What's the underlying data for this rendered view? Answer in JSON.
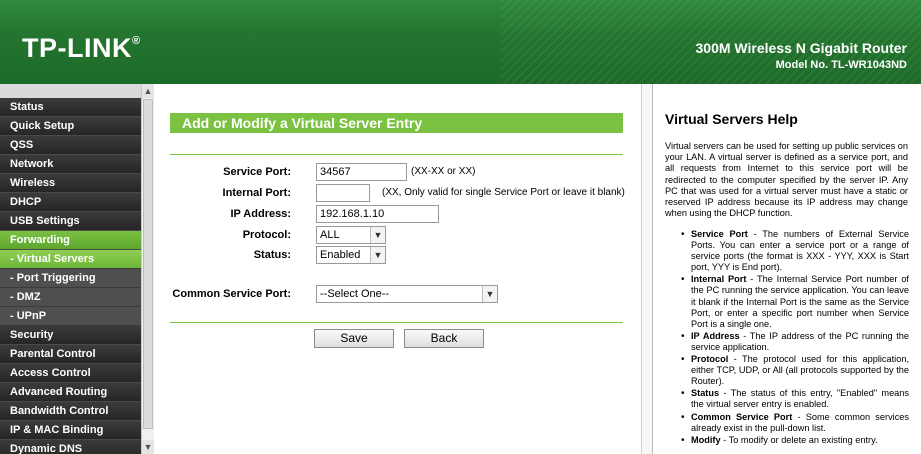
{
  "header": {
    "logo": "TP-LINK",
    "logo_mark": "®",
    "router_name": "300M Wireless N Gigabit Router",
    "model": "Model No. TL-WR1043ND"
  },
  "menu": {
    "items": [
      {
        "label": "Status",
        "type": "main"
      },
      {
        "label": "Quick Setup",
        "type": "main"
      },
      {
        "label": "QSS",
        "type": "main"
      },
      {
        "label": "Network",
        "type": "main"
      },
      {
        "label": "Wireless",
        "type": "main"
      },
      {
        "label": "DHCP",
        "type": "main"
      },
      {
        "label": "USB Settings",
        "type": "main"
      },
      {
        "label": "Forwarding",
        "type": "main",
        "active": true
      },
      {
        "label": "- Virtual Servers",
        "type": "sub",
        "active": true
      },
      {
        "label": "- Port Triggering",
        "type": "sub"
      },
      {
        "label": "- DMZ",
        "type": "sub"
      },
      {
        "label": "- UPnP",
        "type": "sub"
      },
      {
        "label": "Security",
        "type": "main"
      },
      {
        "label": "Parental Control",
        "type": "main"
      },
      {
        "label": "Access Control",
        "type": "main"
      },
      {
        "label": "Advanced Routing",
        "type": "main"
      },
      {
        "label": "Bandwidth Control",
        "type": "main"
      },
      {
        "label": "IP & MAC Binding",
        "type": "main"
      },
      {
        "label": "Dynamic DNS",
        "type": "main"
      }
    ]
  },
  "form": {
    "title": "Add or Modify a Virtual Server Entry",
    "service_port_label": "Service Port:",
    "service_port_value": "34567",
    "service_port_hint": "(XX-XX or XX)",
    "internal_port_label": "Internal Port:",
    "internal_port_value": "",
    "internal_port_hint": "(XX, Only valid for single Service Port or leave it blank)",
    "ip_label": "IP Address:",
    "ip_value": "192.168.1.10",
    "protocol_label": "Protocol:",
    "protocol_value": "ALL",
    "status_label": "Status:",
    "status_value": "Enabled",
    "common_label": "Common Service Port:",
    "common_value": "--Select One--",
    "save": "Save",
    "back": "Back"
  },
  "help": {
    "title": "Virtual Servers Help",
    "intro": "Virtual servers can be used for setting up public services on your LAN. A virtual server is defined as a service port, and all requests from Internet to this service port will be redirected to the computer specified by the server IP. Any PC that was used for a virtual server must have a static or reserved IP address because its IP address may change when using the DHCP function.",
    "items": [
      {
        "term": "Service Port",
        "text": " - The numbers of External Service Ports. You can enter a service port or a range of service ports (the format is XXX - YYY, XXX is Start port, YYY is End port)."
      },
      {
        "term": "Internal Port",
        "text": " - The Internal Service Port number of the PC running the service application. You can leave it blank if the Internal Port is the same as the Service Port, or enter a specific port number when Service Port is a single one."
      },
      {
        "term": "IP Address",
        "text": " - The IP address of the PC running the service application."
      },
      {
        "term": "Protocol",
        "text": " - The protocol used for this application, either TCP, UDP, or All (all protocols supported by the Router)."
      },
      {
        "term": "Status",
        "text": " - The status of this entry, \"Enabled\" means the virtual server entry is enabled."
      },
      {
        "term": "Common Service Port",
        "text": " - Some common services already exist in the pull-down list."
      },
      {
        "term": "Modify",
        "text": " - To modify or delete an existing entry."
      }
    ]
  },
  "colors": {
    "header_green": "#24752f",
    "accent_green": "#7cc242",
    "menu_dark": "#262626"
  }
}
